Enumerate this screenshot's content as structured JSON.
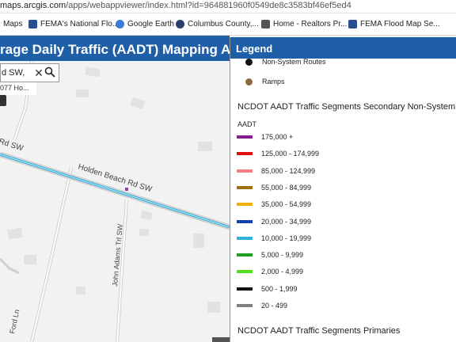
{
  "browser": {
    "url_host": "maps.arcgis.com",
    "url_path": "/apps/webappviewer/index.html?id=964881960f0549de8c3583bf46ef5ed4",
    "bookmarks": [
      {
        "label": "Maps",
        "icon": "bookmark-icon",
        "color": "#ffffff"
      },
      {
        "label": "FEMA's National Flo...",
        "icon": "fema-icon",
        "color": "#2a4f8f"
      },
      {
        "label": "Google Earth",
        "icon": "google-earth-icon",
        "color": "#3a7bd5"
      },
      {
        "label": "Columbus County,...",
        "icon": "county-seal-icon",
        "color": "#2b3f6b"
      },
      {
        "label": "Home - Realtors Pr...",
        "icon": "realtors-icon",
        "color": "#555555"
      },
      {
        "label": "FEMA Flood Map Se...",
        "icon": "fema-flood-icon",
        "color": "#2a4f8f"
      }
    ]
  },
  "app": {
    "title": "rage Daily Traffic (AADT) Mapping Applicatio"
  },
  "search": {
    "value": "d SW,",
    "suggestion": "077 Ho..."
  },
  "map": {
    "roads": [
      {
        "label": "Holden Beach Rd SW"
      },
      {
        "label": "Rd SW"
      },
      {
        "label": "John Adams Trl SW"
      },
      {
        "label": "Ford Ln"
      }
    ]
  },
  "legend": {
    "header": "Legend",
    "points": [
      {
        "label": "Non-System Routes",
        "color": "#111111"
      },
      {
        "label": "Ramps",
        "color": "#8b6a3e"
      }
    ],
    "section_title": "NCDOT AADT Traffic Segments Secondary Non-System",
    "section_sub": "AADT",
    "classes": [
      {
        "label": "175,000 +",
        "color": "#8b1a8f"
      },
      {
        "label": "125,000 - 174,999",
        "color": "#e01010"
      },
      {
        "label": "85,000 - 124,999",
        "color": "#f08080"
      },
      {
        "label": "55,000 - 84,999",
        "color": "#a07010"
      },
      {
        "label": "35,000 - 54,999",
        "color": "#f0b010"
      },
      {
        "label": "20,000 - 34,999",
        "color": "#1040b0"
      },
      {
        "label": "10,000 - 19,999",
        "color": "#30b0e0"
      },
      {
        "label": "5,000 - 9,999",
        "color": "#20a020"
      },
      {
        "label": "2,000 - 4,999",
        "color": "#50e020"
      },
      {
        "label": "500 - 1,999",
        "color": "#111111"
      },
      {
        "label": "20 - 499",
        "color": "#808080"
      }
    ],
    "next_section_title": "NCDOT AADT Traffic Segments Primaries"
  }
}
